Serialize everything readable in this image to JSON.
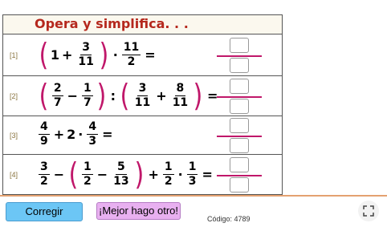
{
  "header": {
    "title": "Opera y simplifica. . ."
  },
  "exercises": [
    {
      "num": "[1]"
    },
    {
      "num": "[2]"
    },
    {
      "num": "[3]"
    },
    {
      "num": "[4]"
    }
  ],
  "ex1": {
    "a": "1",
    "plus": "+",
    "n1": "3",
    "d1": "11",
    "dot": "·",
    "n2": "11",
    "d2": "2",
    "eq": "="
  },
  "ex2": {
    "n1": "2",
    "d1": "7",
    "minus": "−",
    "n2": "1",
    "d2": "7",
    "colon": ":",
    "n3": "3",
    "d3": "11",
    "plus": "+",
    "n4": "8",
    "d4": "11",
    "eq": "="
  },
  "ex3": {
    "n1": "4",
    "d1": "9",
    "plus": "+",
    "b": "2",
    "dot": "·",
    "n2": "4",
    "d2": "3",
    "eq": "="
  },
  "ex4": {
    "n1": "3",
    "d1": "2",
    "minus": "−",
    "n2": "1",
    "d2": "2",
    "minus2": "−",
    "n3": "5",
    "d3": "13",
    "plus": "+",
    "n4": "1",
    "d4": "2",
    "dot": "·",
    "n5": "1",
    "d5": "3",
    "eq": "="
  },
  "buttons": {
    "corregir": "Corregir",
    "otro": "¡Mejor hago otro!"
  },
  "footer": {
    "codigo": "Código: 4789"
  },
  "colors": {
    "title": "#b5281d",
    "paren": "#c0176a",
    "corregir": "#6cc6f5",
    "otro": "#e8b0f0"
  },
  "icons": {
    "expand": "expand-icon"
  }
}
